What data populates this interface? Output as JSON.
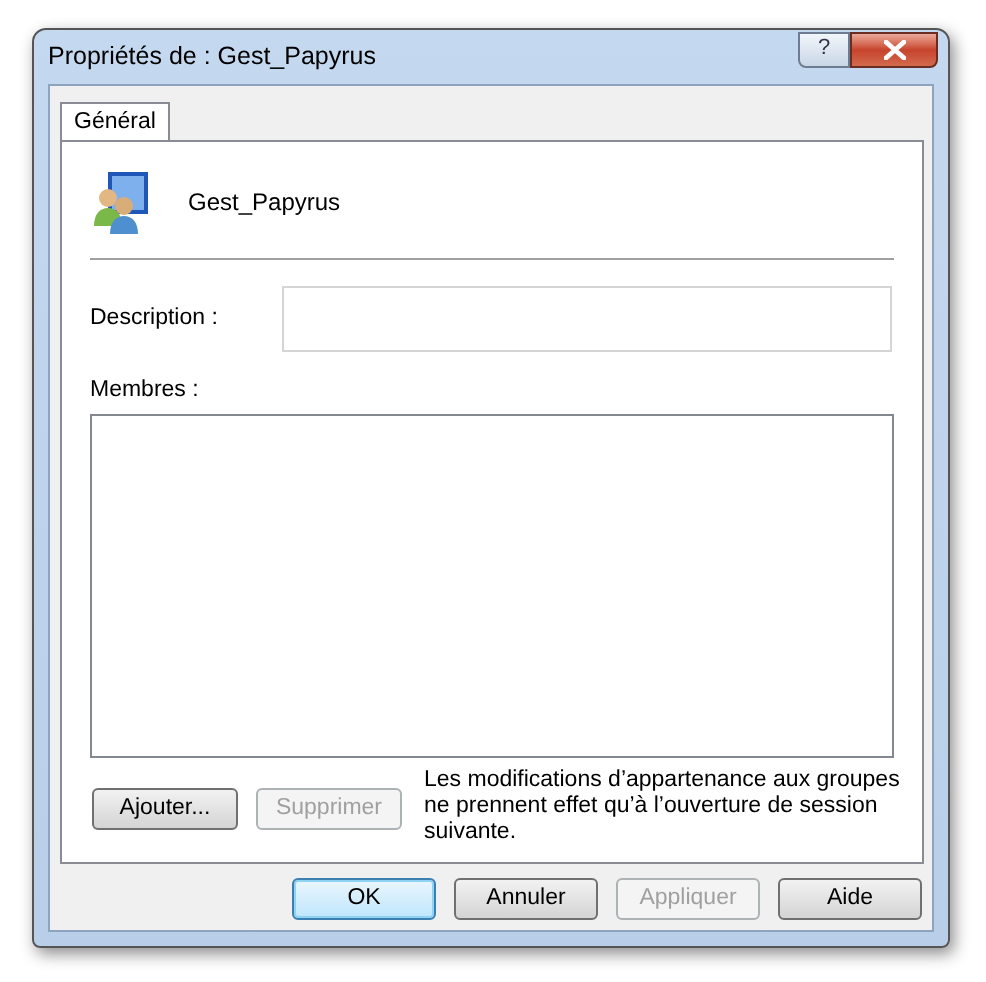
{
  "window": {
    "title": "Propriétés de : Gest_Papyrus",
    "help_button": "?"
  },
  "tabs": [
    {
      "label": "Général",
      "selected": true
    }
  ],
  "group": {
    "name": "Gest_Papyrus"
  },
  "description": {
    "label": "Description :"
  },
  "members": {
    "label": "Membres :"
  },
  "member_buttons": [
    {
      "label": "Ajouter...",
      "disabled": false
    },
    {
      "label": "Supprimer",
      "disabled": true
    }
  ],
  "note": "Les modifications d’appartenance aux groupes ne prennent effet qu’à l’ouverture de session suivante.",
  "buttons": [
    {
      "label": "OK",
      "disabled": false,
      "default": true
    },
    {
      "label": "Annuler",
      "disabled": false,
      "default": false
    },
    {
      "label": "Appliquer",
      "disabled": true,
      "default": false
    },
    {
      "label": "Aide",
      "disabled": false,
      "default": false
    }
  ]
}
